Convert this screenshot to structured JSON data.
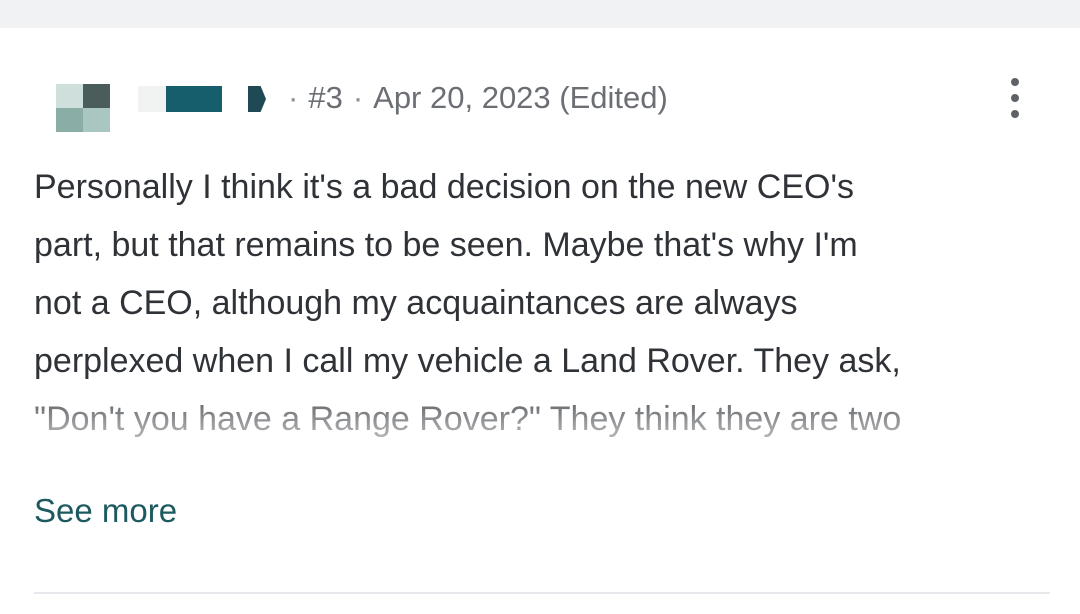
{
  "post": {
    "number": "#3",
    "date": "Apr 20, 2023",
    "edited": "(Edited)",
    "separator": "·",
    "body_lines": [
      "Personally I think it's a bad decision on the new CEO's",
      "part, but that remains to be seen. Maybe that's why I'm",
      "not a CEO, although my acquaintances are always",
      "perplexed when I call my vehicle a Land Rover. They ask,",
      "\"Don't you have a Range Rover?\" They think they are two"
    ],
    "see_more_label": "See more"
  },
  "icons": {
    "menu": "more-vertical-icon"
  },
  "colors": {
    "link": "#1d5a60",
    "text": "#2f3338",
    "meta": "#6b6f74",
    "username_block": "#165e6c"
  }
}
